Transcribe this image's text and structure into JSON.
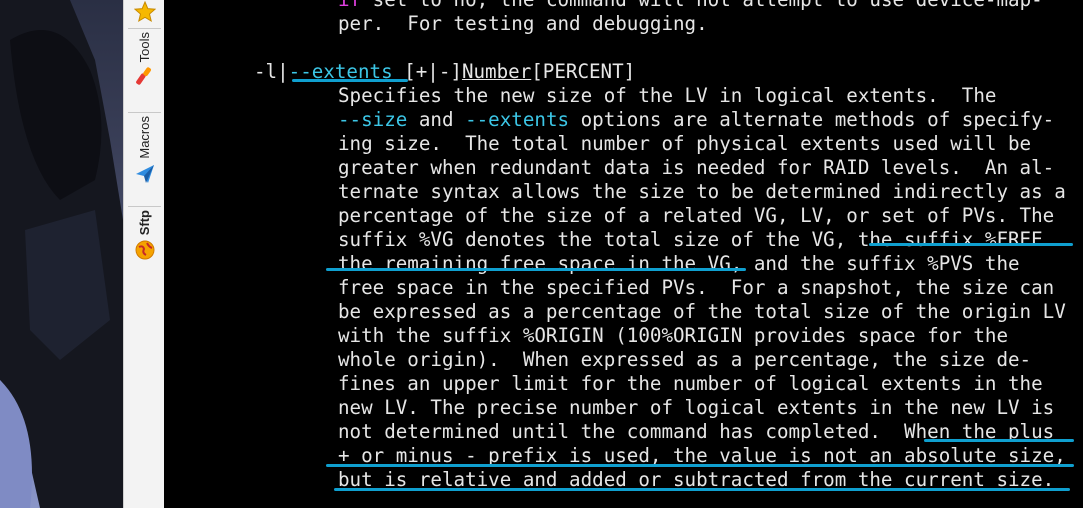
{
  "sidebar": {
    "items": [
      {
        "label": "",
        "icon": "star-icon"
      },
      {
        "label": "Tools",
        "icon": "wrench-icon"
      },
      {
        "label": "Macros",
        "icon": "paper-plane-icon"
      },
      {
        "label": "Sftp",
        "icon": "globe-icon"
      }
    ]
  },
  "terminal": {
    "top_line": {
      "prefix": "if",
      "rest": " set to no, the command will not attempt to use device-map-"
    },
    "line2": "per.  For testing and debugging.",
    "option": {
      "short": "-l|",
      "long": "--extents",
      "sign": " [+|-]",
      "number": "Number",
      "percent": "[PERCENT]"
    },
    "body": [
      "Specifies the new size of the LV in logical extents.  The",
      "ing size.  The total number of physical extents used will be",
      "greater when redundant data is needed for RAID levels.  An al-",
      "ternate syntax allows the size to be determined indirectly as a",
      "percentage of the size of a related VG, LV, or set of PVs. The",
      "suffix %VG denotes the total size of the VG, the suffix %FREE",
      "the remaining free space in the VG, and the suffix %PVS the",
      "free space in the specified PVs.  For a snapshot, the size can",
      "be expressed as a percentage of the total size of the origin LV",
      "with the suffix %ORIGIN (100%ORIGIN provides space for the",
      "whole origin).  When expressed as a percentage, the size de-",
      "fines an upper limit for the number of logical extents in the",
      "new LV. The precise number of logical extents in the new LV is",
      "not determined until the command has completed.  When the plus",
      "+ or minus - prefix is used, the value is not an absolute size,",
      "but is relative and added or subtracted from the current size."
    ],
    "line_size": {
      "opt1": "--size",
      "mid": " and ",
      "opt2": "--extents",
      "rest": " options are alternate methods of specify-"
    }
  }
}
